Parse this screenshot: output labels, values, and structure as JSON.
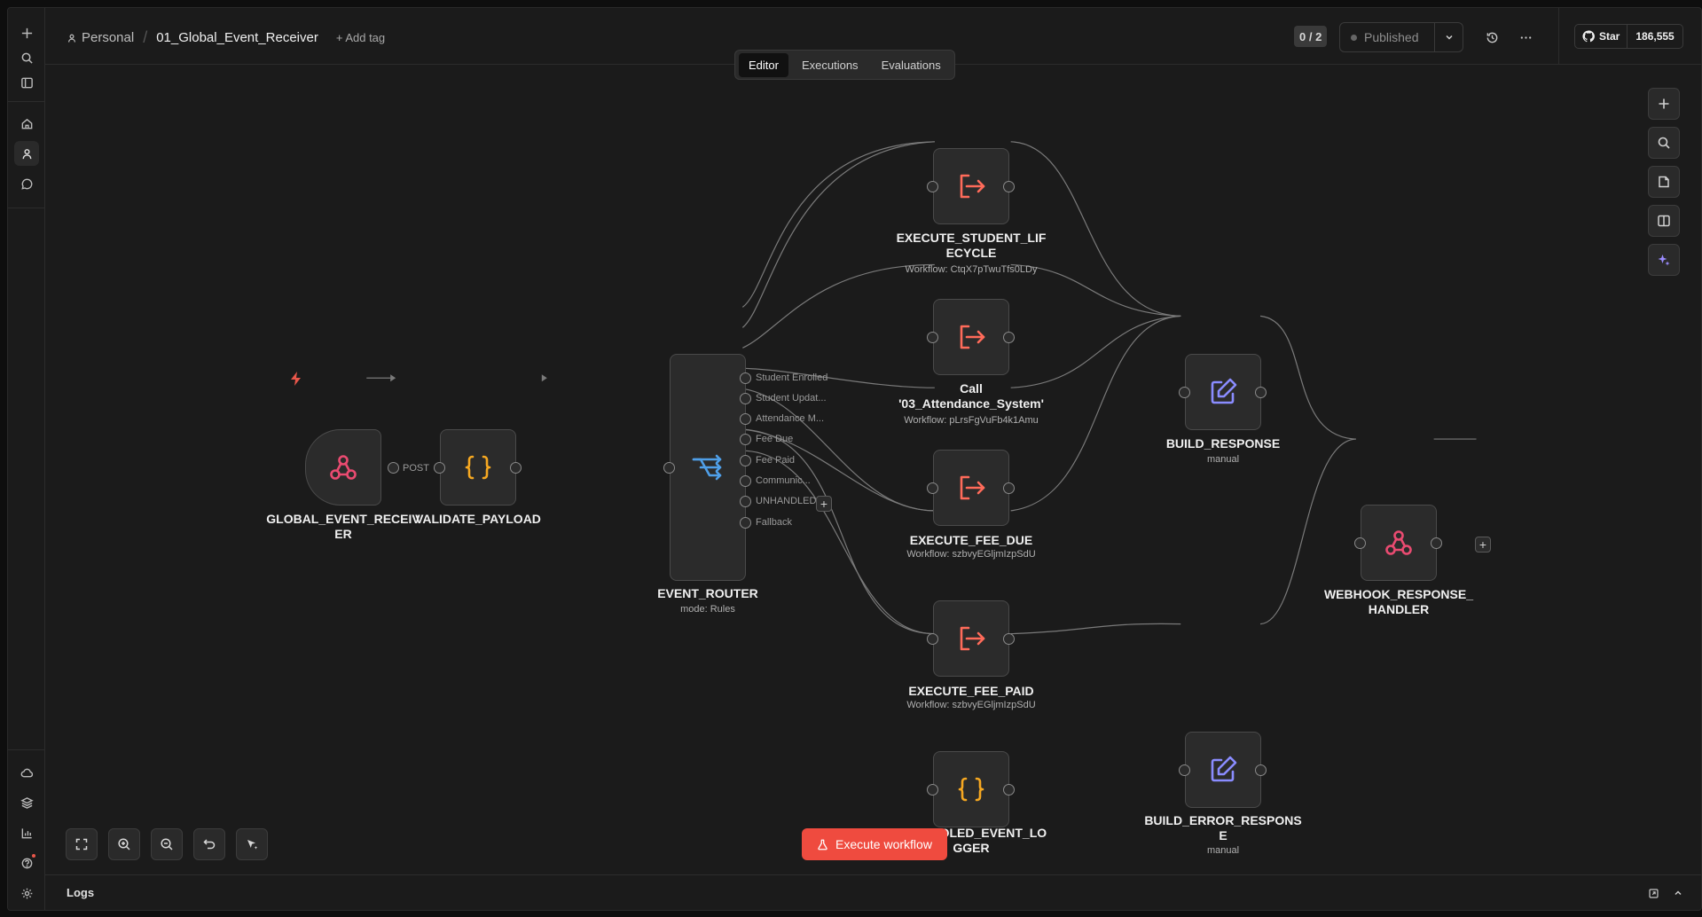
{
  "header": {
    "project": "Personal",
    "workflow_name": "01_Global_Event_Receiver",
    "add_tag": "+ Add tag",
    "tabs": [
      "Editor",
      "Executions",
      "Evaluations"
    ],
    "active_tab": "Editor",
    "counter": "0 / 2",
    "publish_label": "Published",
    "github_star": "Star",
    "github_count": "186,555"
  },
  "nodes": {
    "global_event_receiver": {
      "label": "GLOBAL_EVENT_RECEIV ER",
      "line1": "GLOBAL_EVENT_RECEIV",
      "line2": "ER",
      "output": "POST"
    },
    "validate_payload": {
      "label": "VALIDATE_PAYLOAD"
    },
    "event_router": {
      "label": "EVENT_ROUTER",
      "sub": "mode: Rules",
      "outputs": [
        "Student Enrolled",
        "Student Updat...",
        "Attendance M...",
        "Fee Due",
        "Fee Paid",
        "Communic...",
        "UNHANDLED_...",
        "Fallback"
      ]
    },
    "execute_student_lifecycle": {
      "line1": "EXECUTE_STUDENT_LIF",
      "line2": "ECYCLE",
      "sub": "Workflow: CtqX7pTwuTfs0LDy"
    },
    "call_attendance": {
      "line1": "Call",
      "line2": "'03_Attendance_System'",
      "sub": "Workflow: pLrsFgVuFb4k1Amu"
    },
    "execute_fee_due": {
      "label": "EXECUTE_FEE_DUE",
      "sub": "Workflow: szbvyEGljmIzpSdU"
    },
    "execute_fee_paid": {
      "label": "EXECUTE_FEE_PAID",
      "sub": "Workflow: szbvyEGljmIzpSdU"
    },
    "unhandled_event_logger": {
      "line1": "UNHANDLED_EVENT_LO",
      "line2": "GGER"
    },
    "build_response": {
      "label": "BUILD_RESPONSE",
      "sub": "manual"
    },
    "build_error_response": {
      "line1": "BUILD_ERROR_RESPONS",
      "line2": "E",
      "sub": "manual"
    },
    "webhook_response_handler": {
      "line1": "WEBHOOK_RESPONSE_",
      "line2": "HANDLER"
    }
  },
  "canvas": {
    "execute_button": "Execute workflow"
  },
  "logs": {
    "label": "Logs"
  },
  "colors": {
    "accent": "#ef4b3f",
    "webhook": "#ea4b71",
    "code": "#f6a821",
    "router": "#4f9fe8",
    "execute": "#ff6b5a",
    "set": "#8a8cff"
  }
}
